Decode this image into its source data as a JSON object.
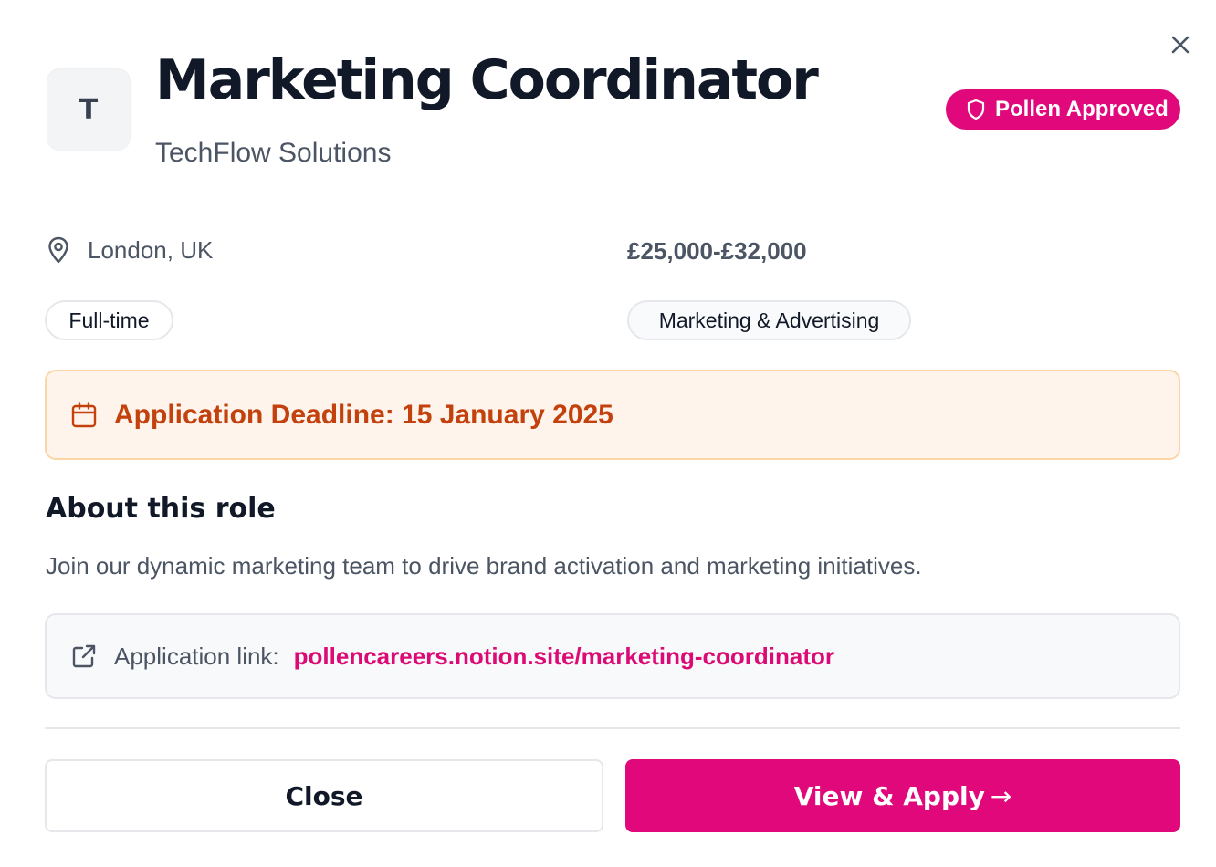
{
  "job": {
    "logo_letter": "T",
    "title": "Marketing Coordinator",
    "company": "TechFlow Solutions",
    "badge_label": "Pollen Approved",
    "location": "London, UK",
    "salary": "£25,000-£32,000",
    "job_type": "Full-time",
    "industry": "Marketing & Advertising"
  },
  "deadline": {
    "text": "Application Deadline: 15 January 2025"
  },
  "about": {
    "heading": "About this role",
    "description": "Join our dynamic marketing team to drive brand activation and marketing initiatives."
  },
  "application": {
    "label": "Application link:",
    "url": "pollencareers.notion.site/marketing-coordinator"
  },
  "actions": {
    "close_label": "Close",
    "apply_label": "View & Apply",
    "apply_arrow": "→"
  },
  "colors": {
    "accent": "#e0087a",
    "deadline_text": "#c2410c",
    "deadline_bg": "#fff4eb"
  },
  "icons": {
    "close": "close-icon",
    "badge": "shield-icon",
    "location": "map-pin-icon",
    "deadline": "calendar-icon",
    "link": "external-link-icon"
  }
}
